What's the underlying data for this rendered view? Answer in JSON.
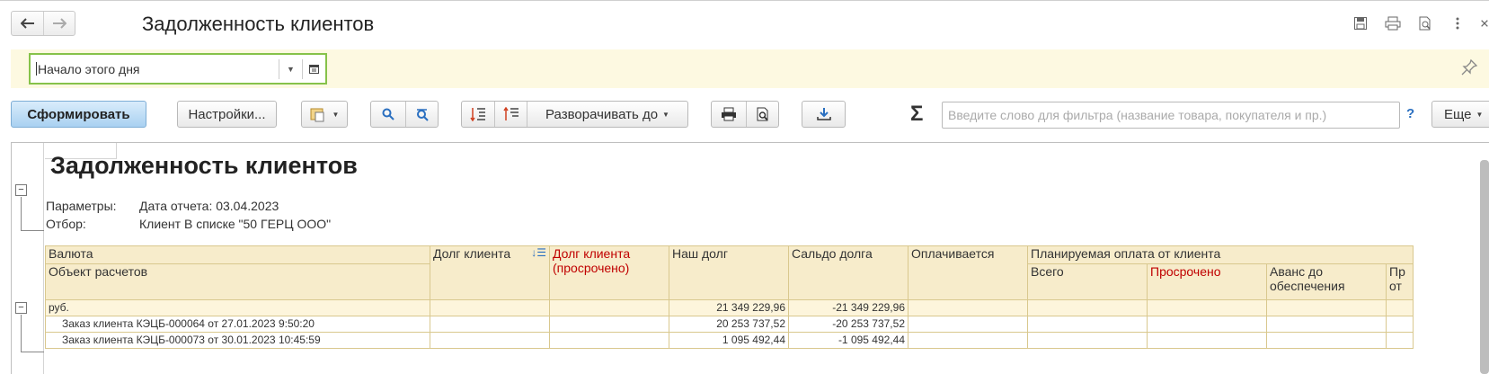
{
  "window": {
    "title": "Задолженность клиентов"
  },
  "params": {
    "period_value": "Начало этого дня"
  },
  "toolbar": {
    "generate_label": "Сформировать",
    "settings_label": "Настройки...",
    "expand_label": "Разворачивать до",
    "filter_placeholder": "Введите слово для фильтра (название товара, покупателя и пр.)",
    "help_label": "?",
    "more_label": "Еще"
  },
  "report": {
    "title": "Задолженность клиентов",
    "param_label": "Параметры:",
    "param_value": "Дата отчета: 03.04.2023",
    "filter_label": "Отбор:",
    "filter_value": "Клиент В списке \"50 ГЕРЦ ООО\"",
    "headers": {
      "currency": "Валюта",
      "settlement_object": "Объект расчетов",
      "client_debt": "Долг клиента",
      "client_debt_overdue_1": "Долг клиента",
      "client_debt_overdue_2": "(просрочено)",
      "our_debt": "Наш долг",
      "debt_balance": "Сальдо долга",
      "being_paid": "Оплачивается",
      "planned_payment": "Планируемая оплата от клиента",
      "total": "Всего",
      "overdue": "Просрочено",
      "advance_1": "Аванс до",
      "advance_2": "обеспечения",
      "pr_1": "Пр",
      "pr_2": "от"
    },
    "group": {
      "name": "руб.",
      "our_debt": "21 349 229,96",
      "balance": "-21 349 229,96"
    },
    "rows": [
      {
        "name": "Заказ клиента КЭЦБ-000064 от 27.01.2023 9:50:20",
        "our_debt": "20 253 737,52",
        "balance": "-20 253 737,52"
      },
      {
        "name": "Заказ клиента КЭЦБ-000073 от 30.01.2023 10:45:59",
        "our_debt": "1 095 492,44",
        "balance": "-1 095 492,44"
      }
    ]
  }
}
